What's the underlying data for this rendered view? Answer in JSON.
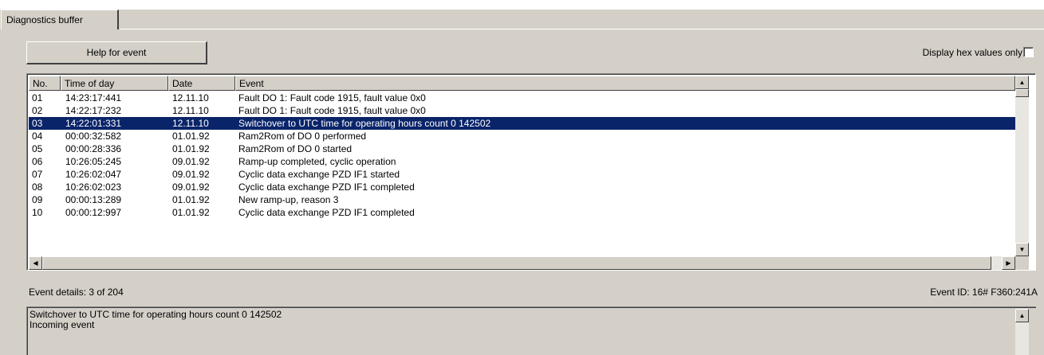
{
  "tab": {
    "label": "Diagnostics buffer"
  },
  "toolbar": {
    "help_label": "Help for event",
    "hex_label": "Display hex values only",
    "hex_checked": false
  },
  "table": {
    "columns": [
      "No.",
      "Time of day",
      "Date",
      "Event"
    ],
    "selected_index": 2,
    "rows": [
      [
        "01",
        "14:23:17:441",
        "12.11.10",
        "Fault DO 1: Fault code 1915, fault value 0x0"
      ],
      [
        "02",
        "14:22:17:232",
        "12.11.10",
        "Fault DO 1: Fault code 1915, fault value 0x0"
      ],
      [
        "03",
        "14:22:01:331",
        "12.11.10",
        "Switchover to UTC time for operating hours count 0 142502"
      ],
      [
        "04",
        "00:00:32:582",
        "01.01.92",
        "Ram2Rom of DO 0 performed"
      ],
      [
        "05",
        "00:00:28:336",
        "01.01.92",
        "Ram2Rom of DO 0 started"
      ],
      [
        "06",
        "10:26:05:245",
        "09.01.92",
        "Ramp-up completed, cyclic operation"
      ],
      [
        "07",
        "10:26:02:047",
        "09.01.92",
        "Cyclic data exchange PZD IF1 started"
      ],
      [
        "08",
        "10:26:02:023",
        "09.01.92",
        "Cyclic data exchange PZD IF1 completed"
      ],
      [
        "09",
        "00:00:13:289",
        "01.01.92",
        "New ramp-up, reason 3"
      ],
      [
        "10",
        "00:00:12:997",
        "01.01.92",
        "Cyclic data exchange PZD IF1 completed"
      ]
    ]
  },
  "details": {
    "label": "Event details:  3 of 204",
    "event_id": "Event ID: 16# F360:241A",
    "lines": [
      "Switchover to UTC time for operating hours count 0 142502",
      "Incoming event"
    ]
  },
  "icons": {
    "scroll_up": "scroll-up-arrow-icon",
    "scroll_down": "scroll-down-arrow-icon",
    "scroll_left": "scroll-left-arrow-icon",
    "scroll_right": "scroll-right-arrow-icon",
    "checkbox": "checkbox-icon"
  },
  "colors": {
    "window_bg": "#d4d0c8",
    "selection_bg": "#0a246a",
    "selection_fg": "#ffffff",
    "list_bg": "#ffffff"
  }
}
